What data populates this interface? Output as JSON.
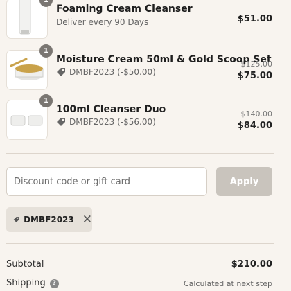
{
  "cart": {
    "items": [
      {
        "quantity": "1",
        "name": "Foaming Cream Cleanser",
        "subtitle": "Deliver every 90 Days",
        "price": "$51.00"
      },
      {
        "quantity": "1",
        "name": "Moisture Cream 50ml & Gold Scoop Set",
        "discount": "DMBF2023 (-$50.00)",
        "original_price": "$125.00",
        "price": "$75.00"
      },
      {
        "quantity": "1",
        "name": "100ml Cleanser Duo",
        "discount": "DMBF2023 (-$56.00)",
        "original_price": "$140.00",
        "price": "$84.00"
      }
    ]
  },
  "discount": {
    "placeholder": "Discount code or gift card",
    "apply_label": "Apply",
    "applied_code": "DMBF2023",
    "remove_symbol": "✕"
  },
  "summary": {
    "subtotal_label": "Subtotal",
    "subtotal_value": "$210.00",
    "shipping_label": "Shipping",
    "help_symbol": "?",
    "shipping_value": "Calculated at next step"
  },
  "colors": {
    "background": "#f8f4ef",
    "apply_button": "#c9c4bd",
    "badge": "#7a7672"
  }
}
